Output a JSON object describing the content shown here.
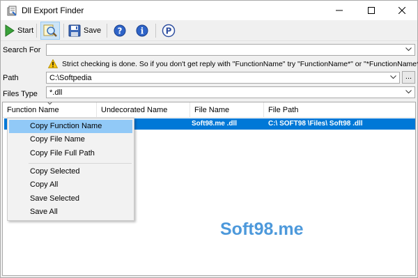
{
  "window": {
    "title": "Dll Export Finder",
    "minimize_label": "—",
    "maximize_label": "□",
    "close_label": "✕"
  },
  "toolbar": {
    "start_label": "Start",
    "save_label": "Save",
    "icons": [
      "play-icon",
      "search-icon",
      "save-icon",
      "help-icon",
      "info-icon",
      "about-icon"
    ]
  },
  "fields": {
    "search_for_label": "Search For",
    "search_for_value": "",
    "hint_text": "Strict checking is done. So if you don't get reply with \"FunctionName\" try \"FunctionName*\" or \"*FunctionName*\"",
    "path_label": "Path",
    "path_value": "C:\\Softpedia",
    "browse_label": "...",
    "files_type_label": "Files Type",
    "files_type_value": "*.dll"
  },
  "listview": {
    "columns": [
      "Function Name",
      "Undecorated Name",
      "File Name",
      "File Path"
    ],
    "selected_row": {
      "function_name": "",
      "undecorated_name": "",
      "file_name": "Soft98.me .dll",
      "file_path": "C:\\  SOFT98  \\Files\\  Soft98  .dll"
    }
  },
  "context_menu": {
    "items": [
      "Copy Function Name",
      "Copy File Name",
      "Copy File Full Path",
      "Copy Selected",
      "Copy All",
      "Save Selected",
      "Save All"
    ],
    "highlighted_index": 0
  },
  "watermark": "Soft98.me",
  "colors": {
    "selection": "#0078d7",
    "menu_highlight": "#91c9f7",
    "hint_warning": "#f5c211",
    "watermark": "#3a8fd8"
  }
}
